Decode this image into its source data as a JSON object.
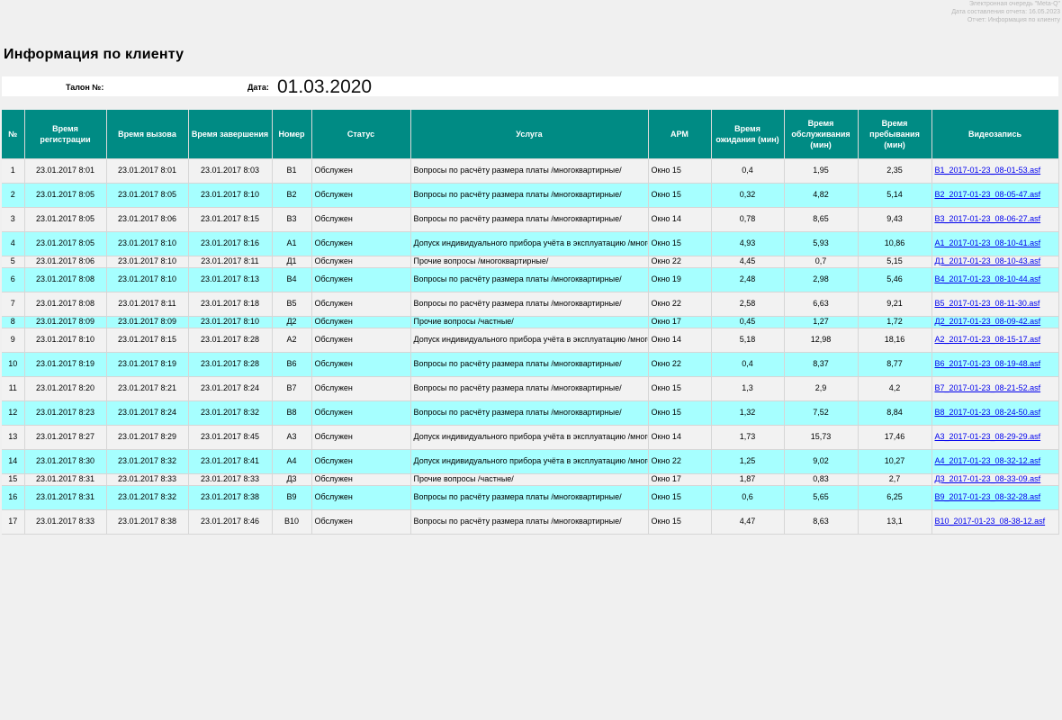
{
  "report_meta": {
    "system": "Электронная очередь \"Meta-Q\"",
    "compiled": "Дата составления отчета: 16.05.2023",
    "report": "Отчет: Информация по клиенту"
  },
  "page_title": "Информация по клиенту",
  "filter": {
    "ticket_label": "Талон №:",
    "ticket_value": "",
    "date_label": "Дата:",
    "date_value": "01.03.2020"
  },
  "columns": [
    "№",
    "Время регистрации",
    "Время вызова",
    "Время завершения",
    "Номер",
    "Статус",
    "Услуга",
    "АРМ",
    "Время ожидания (мин)",
    "Время обслуживания (мин)",
    "Время пребывания (мин)",
    "Видеозапись"
  ],
  "rows": [
    {
      "n": "1",
      "reg": "23.01.2017 8:01",
      "call": "23.01.2017 8:01",
      "end": "23.01.2017 8:03",
      "num": "В1",
      "status": "Обслужен",
      "service": "Вопросы по расчёту размера платы /многоквартирные/",
      "arm": "Окно 15",
      "wait": "0,4",
      "serve": "1,95",
      "stay": "2,35",
      "video": "В1_2017-01-23_08-01-53.asf"
    },
    {
      "n": "2",
      "reg": "23.01.2017 8:05",
      "call": "23.01.2017 8:05",
      "end": "23.01.2017 8:10",
      "num": "В2",
      "status": "Обслужен",
      "service": "Вопросы по расчёту размера платы /многоквартирные/",
      "arm": "Окно 15",
      "wait": "0,32",
      "serve": "4,82",
      "stay": "5,14",
      "video": "В2_2017-01-23_08-05-47.asf"
    },
    {
      "n": "3",
      "reg": "23.01.2017 8:05",
      "call": "23.01.2017 8:06",
      "end": "23.01.2017 8:15",
      "num": "В3",
      "status": "Обслужен",
      "service": "Вопросы по расчёту размера платы /многоквартирные/",
      "arm": "Окно 14",
      "wait": "0,78",
      "serve": "8,65",
      "stay": "9,43",
      "video": "В3_2017-01-23_08-06-27.asf"
    },
    {
      "n": "4",
      "reg": "23.01.2017 8:05",
      "call": "23.01.2017 8:10",
      "end": "23.01.2017 8:16",
      "num": "А1",
      "status": "Обслужен",
      "service": "Допуск индивидуального прибора учёта в эксплуатацию /многоквартирные/",
      "arm": "Окно 15",
      "wait": "4,93",
      "serve": "5,93",
      "stay": "10,86",
      "video": "А1_2017-01-23_08-10-41.asf"
    },
    {
      "n": "5",
      "reg": "23.01.2017 8:06",
      "call": "23.01.2017 8:10",
      "end": "23.01.2017 8:11",
      "num": "Д1",
      "status": "Обслужен",
      "service": "Прочие вопросы /многоквартирные/",
      "arm": "Окно 22",
      "wait": "4,45",
      "serve": "0,7",
      "stay": "5,15",
      "video": "Д1_2017-01-23_08-10-43.asf"
    },
    {
      "n": "6",
      "reg": "23.01.2017 8:08",
      "call": "23.01.2017 8:10",
      "end": "23.01.2017 8:13",
      "num": "В4",
      "status": "Обслужен",
      "service": "Вопросы по расчёту размера платы /многоквартирные/",
      "arm": "Окно 19",
      "wait": "2,48",
      "serve": "2,98",
      "stay": "5,46",
      "video": "В4_2017-01-23_08-10-44.asf"
    },
    {
      "n": "7",
      "reg": "23.01.2017 8:08",
      "call": "23.01.2017 8:11",
      "end": "23.01.2017 8:18",
      "num": "В5",
      "status": "Обслужен",
      "service": "Вопросы по расчёту размера платы /многоквартирные/",
      "arm": "Окно 22",
      "wait": "2,58",
      "serve": "6,63",
      "stay": "9,21",
      "video": "В5_2017-01-23_08-11-30.asf"
    },
    {
      "n": "8",
      "reg": "23.01.2017 8:09",
      "call": "23.01.2017 8:09",
      "end": "23.01.2017 8:10",
      "num": "Д2",
      "status": "Обслужен",
      "service": "Прочие вопросы /частные/",
      "arm": "Окно 17",
      "wait": "0,45",
      "serve": "1,27",
      "stay": "1,72",
      "video": "Д2_2017-01-23_08-09-42.asf"
    },
    {
      "n": "9",
      "reg": "23.01.2017 8:10",
      "call": "23.01.2017 8:15",
      "end": "23.01.2017 8:28",
      "num": "А2",
      "status": "Обслужен",
      "service": "Допуск индивидуального прибора учёта в эксплуатацию /многоквартирные/",
      "arm": "Окно 14",
      "wait": "5,18",
      "serve": "12,98",
      "stay": "18,16",
      "video": "А2_2017-01-23_08-15-17.asf"
    },
    {
      "n": "10",
      "reg": "23.01.2017 8:19",
      "call": "23.01.2017 8:19",
      "end": "23.01.2017 8:28",
      "num": "В6",
      "status": "Обслужен",
      "service": "Вопросы по расчёту размера платы /многоквартирные/",
      "arm": "Окно 22",
      "wait": "0,4",
      "serve": "8,37",
      "stay": "8,77",
      "video": "В6_2017-01-23_08-19-48.asf"
    },
    {
      "n": "11",
      "reg": "23.01.2017 8:20",
      "call": "23.01.2017 8:21",
      "end": "23.01.2017 8:24",
      "num": "В7",
      "status": "Обслужен",
      "service": "Вопросы по расчёту размера платы /многоквартирные/",
      "arm": "Окно 15",
      "wait": "1,3",
      "serve": "2,9",
      "stay": "4,2",
      "video": "В7_2017-01-23_08-21-52.asf"
    },
    {
      "n": "12",
      "reg": "23.01.2017 8:23",
      "call": "23.01.2017 8:24",
      "end": "23.01.2017 8:32",
      "num": "В8",
      "status": "Обслужен",
      "service": "Вопросы по расчёту размера платы /многоквартирные/",
      "arm": "Окно 15",
      "wait": "1,32",
      "serve": "7,52",
      "stay": "8,84",
      "video": "В8_2017-01-23_08-24-50.asf"
    },
    {
      "n": "13",
      "reg": "23.01.2017 8:27",
      "call": "23.01.2017 8:29",
      "end": "23.01.2017 8:45",
      "num": "А3",
      "status": "Обслужен",
      "service": "Допуск индивидуального прибора учёта в эксплуатацию /многоквартирные/",
      "arm": "Окно 14",
      "wait": "1,73",
      "serve": "15,73",
      "stay": "17,46",
      "video": "А3_2017-01-23_08-29-29.asf"
    },
    {
      "n": "14",
      "reg": "23.01.2017 8:30",
      "call": "23.01.2017 8:32",
      "end": "23.01.2017 8:41",
      "num": "А4",
      "status": "Обслужен",
      "service": "Допуск индивидуального прибора учёта в эксплуатацию /многоквартирные/",
      "arm": "Окно 22",
      "wait": "1,25",
      "serve": "9,02",
      "stay": "10,27",
      "video": "А4_2017-01-23_08-32-12.asf"
    },
    {
      "n": "15",
      "reg": "23.01.2017 8:31",
      "call": "23.01.2017 8:33",
      "end": "23.01.2017 8:33",
      "num": "Д3",
      "status": "Обслужен",
      "service": "Прочие вопросы /частные/",
      "arm": "Окно 17",
      "wait": "1,87",
      "serve": "0,83",
      "stay": "2,7",
      "video": "Д3_2017-01-23_08-33-09.asf"
    },
    {
      "n": "16",
      "reg": "23.01.2017 8:31",
      "call": "23.01.2017 8:32",
      "end": "23.01.2017 8:38",
      "num": "В9",
      "status": "Обслужен",
      "service": "Вопросы по расчёту размера платы /многоквартирные/",
      "arm": "Окно 15",
      "wait": "0,6",
      "serve": "5,65",
      "stay": "6,25",
      "video": "В9_2017-01-23_08-32-28.asf"
    },
    {
      "n": "17",
      "reg": "23.01.2017 8:33",
      "call": "23.01.2017 8:38",
      "end": "23.01.2017 8:46",
      "num": "В10",
      "status": "Обслужен",
      "service": "Вопросы по расчёту размера платы /многоквартирные/",
      "arm": "Окно 15",
      "wait": "4,47",
      "serve": "8,63",
      "stay": "13,1",
      "video": "В10_2017-01-23_08-38-12.asf"
    }
  ],
  "colors": {
    "header": "#008b84",
    "row_alt": "#a6ffff",
    "row_base": "#f2f2f2",
    "link": "#0000ee"
  }
}
